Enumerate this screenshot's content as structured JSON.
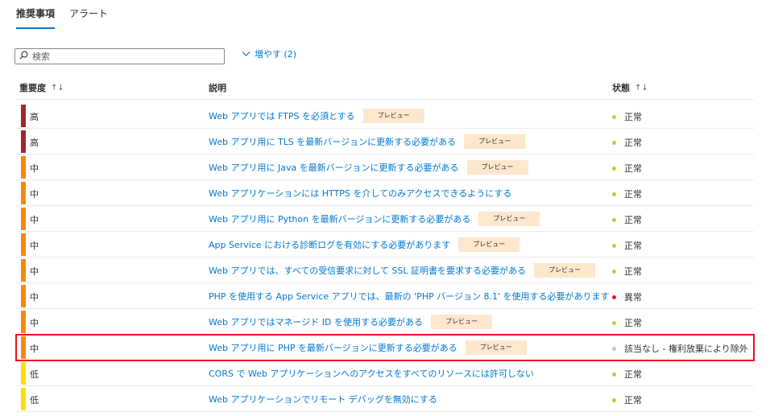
{
  "tabs": [
    {
      "label": "推奨事項",
      "active": true
    },
    {
      "label": "アラート",
      "active": false
    }
  ],
  "search": {
    "placeholder": "検索",
    "icon": "search-icon"
  },
  "expand": {
    "label": "増やす (2)",
    "icon": "chevron-down-icon"
  },
  "columns": {
    "severity": {
      "label": "重要度",
      "sort": "↑↓"
    },
    "description": {
      "label": "説明"
    },
    "status": {
      "label": "状態",
      "sort": "↑↓"
    }
  },
  "severity_colors": {
    "高": "#a4262c",
    "中": "#f7870f",
    "低": "#fce100"
  },
  "status_colors": {
    "正常": "#b3d334",
    "異常": "#e81123",
    "該当なし - 権利放棄により除外": "#c8c6c4"
  },
  "badge_label": "プレビュー",
  "rows": [
    {
      "severity": "高",
      "description": "Web アプリでは FTPS を必須とする",
      "preview": true,
      "status": "正常"
    },
    {
      "severity": "高",
      "description": "Web アプリ用に TLS を最新バージョンに更新する必要がある",
      "preview": true,
      "status": "正常"
    },
    {
      "severity": "中",
      "description": "Web アプリ用に Java を最新バージョンに更新する必要がある",
      "preview": true,
      "status": "正常"
    },
    {
      "severity": "中",
      "description": "Web アプリケーションには HTTPS を介してのみアクセスできるようにする",
      "preview": false,
      "status": "正常"
    },
    {
      "severity": "中",
      "description": "Web アプリ用に Python を最新バージョンに更新する必要がある",
      "preview": true,
      "status": "正常"
    },
    {
      "severity": "中",
      "description": "App Service における診断ログを有効にする必要があります",
      "preview": true,
      "status": "正常"
    },
    {
      "severity": "中",
      "description": "Web アプリでは、すべての受信要求に対して SSL 証明書を要求する必要がある",
      "preview": true,
      "status": "正常"
    },
    {
      "severity": "中",
      "description": "PHP を使用する App Service アプリでは、最新の 'PHP バージョン 8.1' を使用する必要があります",
      "preview": false,
      "status": "異常"
    },
    {
      "severity": "中",
      "description": "Web アプリではマネージド ID を使用する必要がある",
      "preview": true,
      "status": "正常"
    },
    {
      "severity": "中",
      "description": "Web アプリ用に PHP を最新バージョンに更新する必要がある",
      "preview": true,
      "status": "該当なし - 権利放棄により除外",
      "highlighted": true
    },
    {
      "severity": "低",
      "description": "CORS で Web アプリケーションへのアクセスをすべてのリソースには許可しない",
      "preview": false,
      "status": "正常"
    },
    {
      "severity": "低",
      "description": "Web アプリケーションでリモート デバッグを無効にする",
      "preview": false,
      "status": "正常"
    }
  ]
}
